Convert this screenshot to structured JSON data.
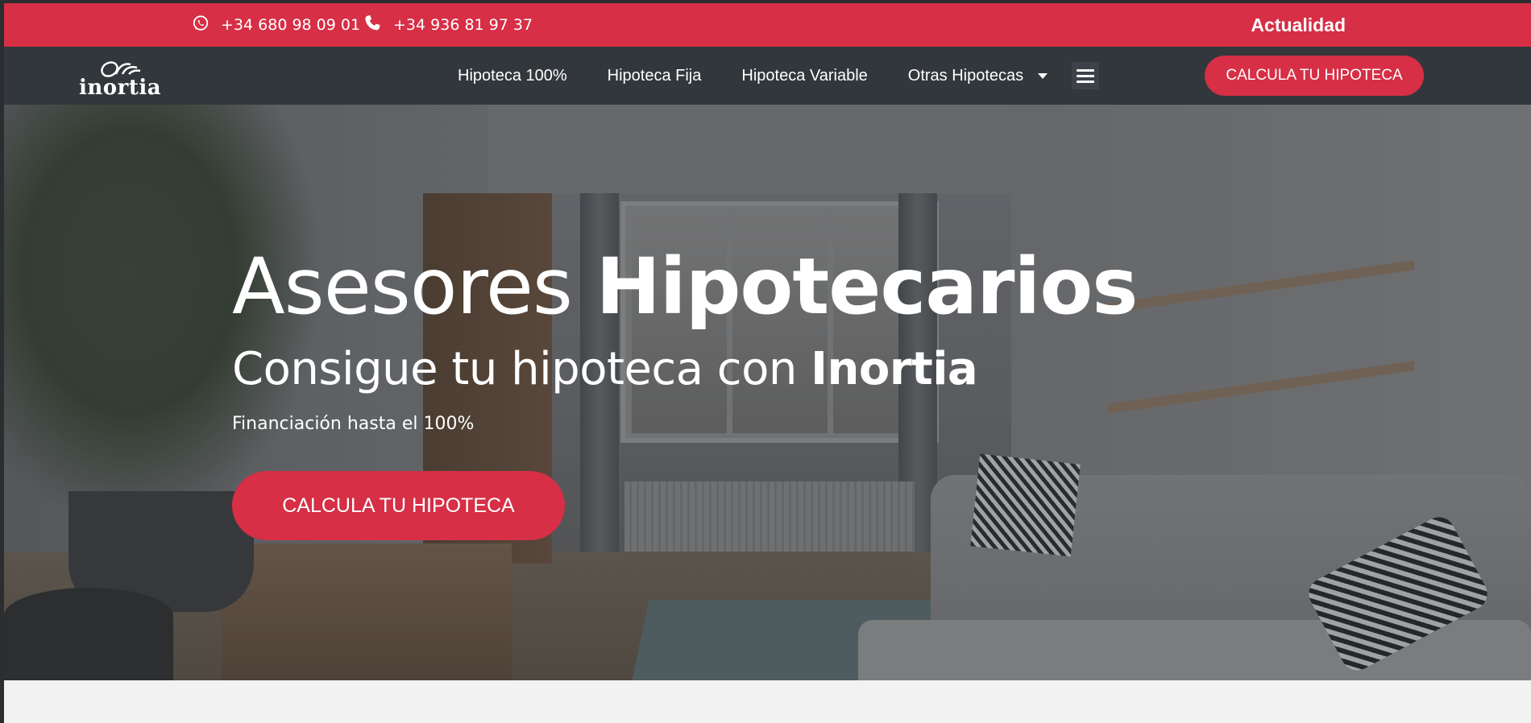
{
  "topbar": {
    "whatsapp_icon": "whatsapp-icon",
    "whatsapp_phone": "+34 680 98 09 01",
    "phone_icon": "phone-icon",
    "phone": "+34 936 81 97 37",
    "actualidad_label": "Actualidad",
    "background_color": "#d62f46"
  },
  "navbar": {
    "logo_text": "inortia",
    "links": [
      {
        "label": "Hipoteca 100%"
      },
      {
        "label": "Hipoteca Fija"
      },
      {
        "label": "Hipoteca Variable"
      },
      {
        "label": "Otras Hipotecas"
      }
    ],
    "menu_icon": "hamburger-menu-icon",
    "cta_label": "CALCULA TU HIPOTECA",
    "background_color": "#32373c"
  },
  "hero": {
    "title_light": "Asesores ",
    "title_bold": "Hipotecarios",
    "subtitle_light": "Consigue tu hipoteca con ",
    "subtitle_bold": "Inortia",
    "note": "Financiación hasta el 100%",
    "cta_label": "CALCULA TU HIPOTECA"
  },
  "accent_color": "#d62f46"
}
